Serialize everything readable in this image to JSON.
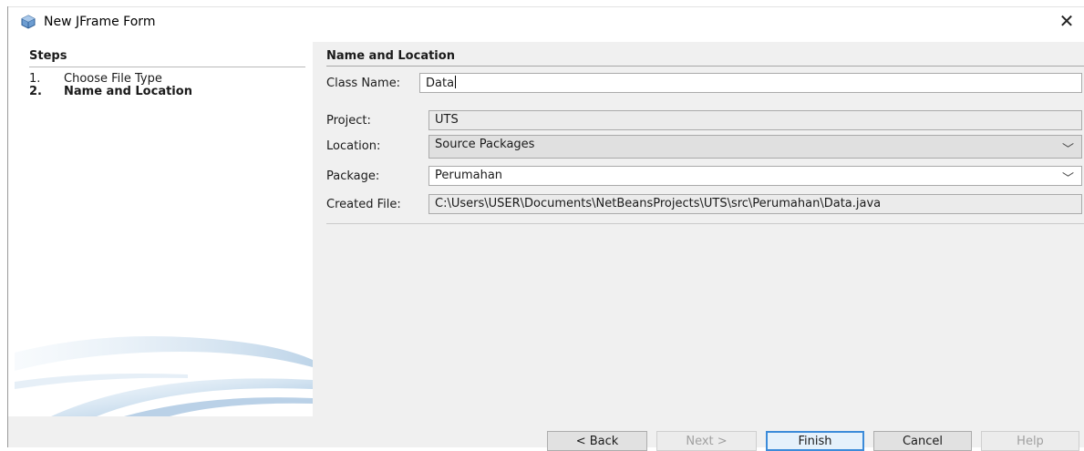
{
  "window": {
    "title": "New JFrame Form"
  },
  "steps": {
    "title": "Steps",
    "items": [
      {
        "num": "1.",
        "label": "Choose File Type"
      },
      {
        "num": "2.",
        "label": "Name and Location"
      }
    ]
  },
  "form": {
    "section_title": "Name and Location",
    "class_name": {
      "label": "Class Name:",
      "value": "Data"
    },
    "project": {
      "label": "Project:",
      "value": "UTS"
    },
    "location": {
      "label": "Location:",
      "value": "Source Packages"
    },
    "package": {
      "label": "Package:",
      "value": "Perumahan"
    },
    "created_file": {
      "label": "Created File:",
      "value": "C:\\Users\\USER\\Documents\\NetBeansProjects\\UTS\\src\\Perumahan\\Data.java"
    }
  },
  "buttons": {
    "back": "< Back",
    "next": "Next >",
    "finish": "Finish",
    "cancel": "Cancel",
    "help": "Help"
  },
  "colors": {
    "accent": "#3c8bd9",
    "panel_bg": "#f0f0f0"
  },
  "icons": {
    "app": "netbeans-cube-icon",
    "close": "close-icon",
    "dropdown": "chevron-down-icon"
  }
}
